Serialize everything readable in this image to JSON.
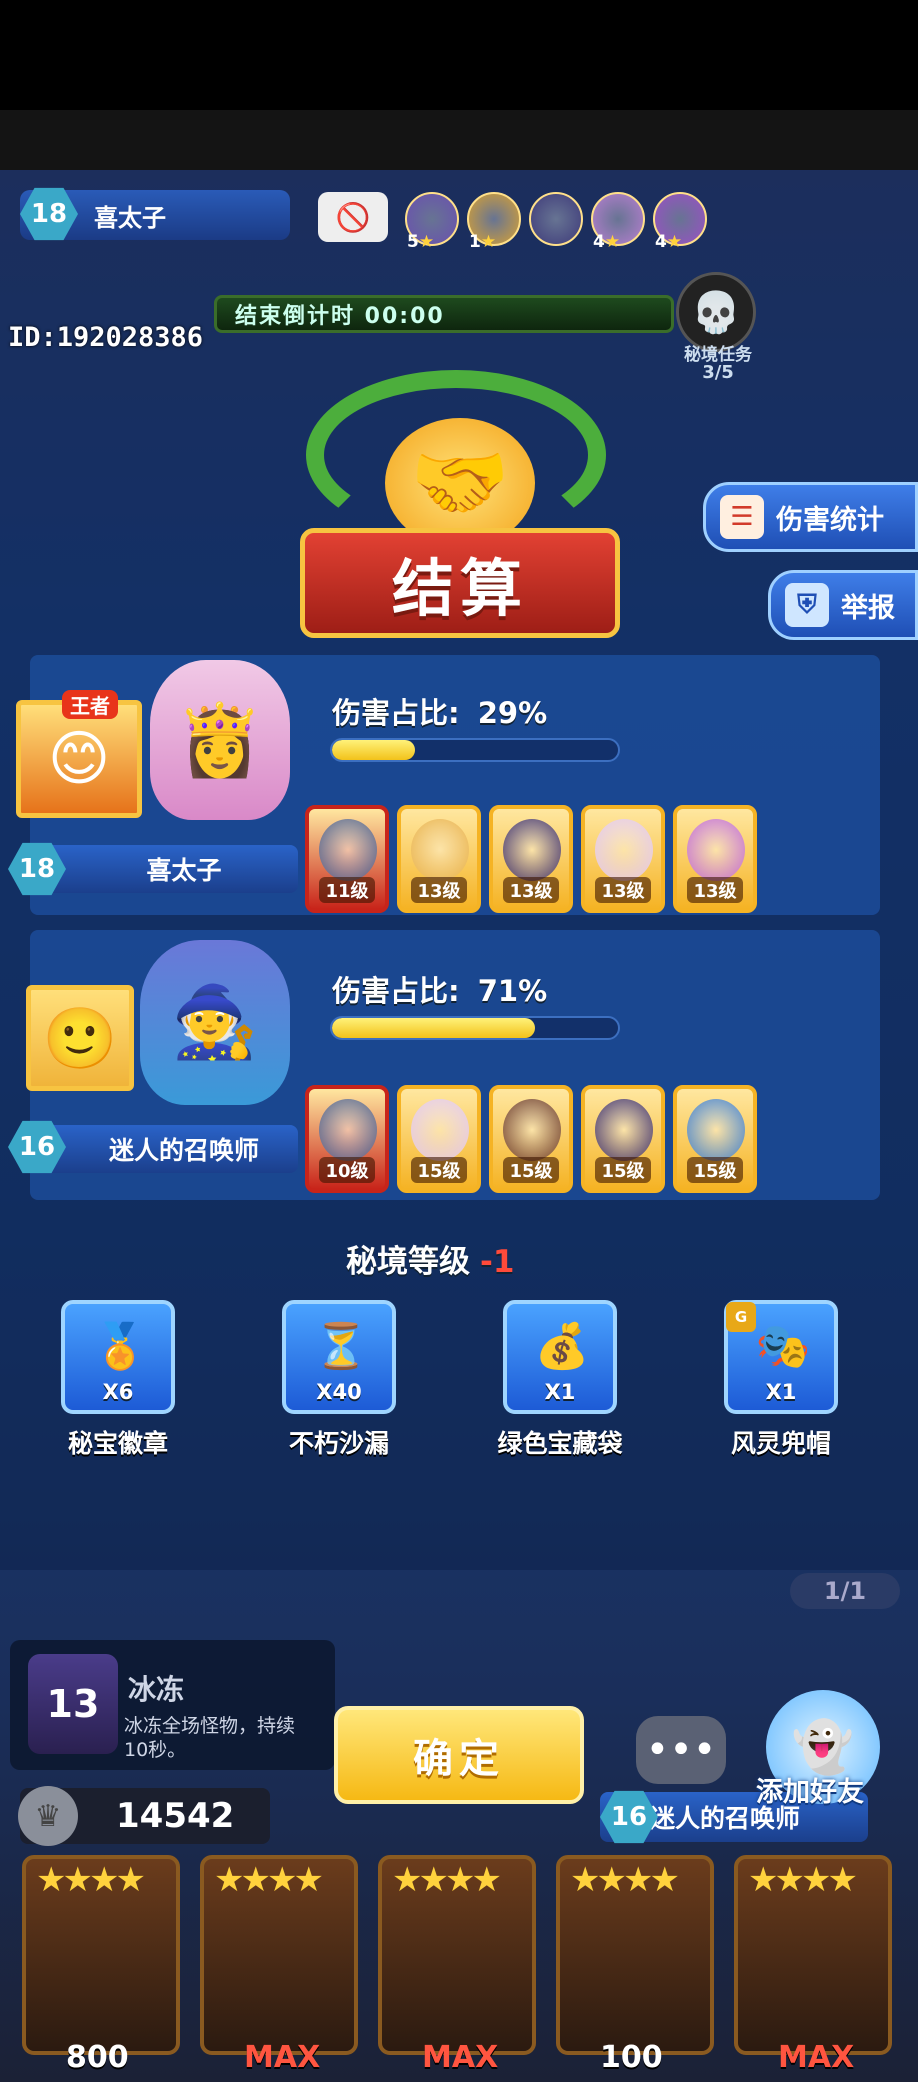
{
  "hud": {
    "player_level": "18",
    "player_name": "喜太子",
    "no_entry_icon": "🚫",
    "team_heroes": [
      {
        "stars": "5",
        "color": "#6a4fb0"
      },
      {
        "stars": "1",
        "color": "#d8a233"
      },
      {
        "stars": "",
        "color": "#3e3a7a"
      },
      {
        "stars": "4",
        "color": "#b87fd1"
      },
      {
        "stars": "4",
        "color": "#9b4fc6"
      }
    ],
    "countdown": "结束倒计时 00:00",
    "player_id": "ID:192028386",
    "boss_label": "秘境任务",
    "boss_progress": "3/5"
  },
  "side_buttons": {
    "damage_stats": "伤害统计",
    "report": "举报"
  },
  "title": "结算",
  "players": [
    {
      "level": "18",
      "name": "喜太子",
      "damage_label": "伤害占比:",
      "damage_value": "29%",
      "damage_fraction": 0.29,
      "badge": "王者",
      "heroes": [
        {
          "level": "11级",
          "border": "#c8241a",
          "face": "#4a5e8c"
        },
        {
          "level": "13级",
          "border": "#f5b324",
          "face": "#e8b14a"
        },
        {
          "level": "13级",
          "border": "#f5b324",
          "face": "#3c2f6e"
        },
        {
          "level": "13级",
          "border": "#f5b324",
          "face": "#e2c7ee"
        },
        {
          "level": "13级",
          "border": "#f5b324",
          "face": "#c06ad8"
        }
      ]
    },
    {
      "level": "16",
      "name": "迷人的召唤师",
      "damage_label": "伤害占比:",
      "damage_value": "71%",
      "damage_fraction": 0.71,
      "heroes": [
        {
          "level": "10级",
          "border": "#c8241a",
          "face": "#4a5e8c"
        },
        {
          "level": "15级",
          "border": "#f5b324",
          "face": "#e2c7ee"
        },
        {
          "level": "15级",
          "border": "#f5b324",
          "face": "#6b3a2a"
        },
        {
          "level": "15级",
          "border": "#f5b324",
          "face": "#3c2f6e"
        },
        {
          "level": "15级",
          "border": "#f5b324",
          "face": "#3e7fd0"
        }
      ]
    }
  ],
  "rewards": {
    "title": "秘境等级",
    "level_change": "-1",
    "items": [
      {
        "name": "秘宝徽章",
        "count": "X6",
        "icon": "🏅"
      },
      {
        "name": "不朽沙漏",
        "count": "X40",
        "icon": "⏳"
      },
      {
        "name": "绿色宝藏袋",
        "count": "X1",
        "icon": "💰"
      },
      {
        "name": "风灵兜帽",
        "count": "X1",
        "icon": "🎭",
        "badge": "G"
      }
    ]
  },
  "skill": {
    "level": "13",
    "name": "冰冻",
    "desc": "冰冻全场怪物，持续10秒。"
  },
  "confirm_label": "确定",
  "add_friend_label": "添加好友",
  "chat_icon": "•••",
  "wave_indicator": "1/1",
  "opponent": {
    "level": "16",
    "name": "迷人的召唤师"
  },
  "coins": "14542",
  "deck": [
    {
      "stars": "★★★★",
      "cost": "800",
      "is_max": false
    },
    {
      "stars": "★★★★",
      "cost": "MAX",
      "is_max": true
    },
    {
      "stars": "★★★★",
      "cost": "MAX",
      "is_max": true
    },
    {
      "stars": "★★★★",
      "cost": "100",
      "is_max": false
    },
    {
      "stars": "★★★★",
      "cost": "MAX",
      "is_max": true
    }
  ]
}
